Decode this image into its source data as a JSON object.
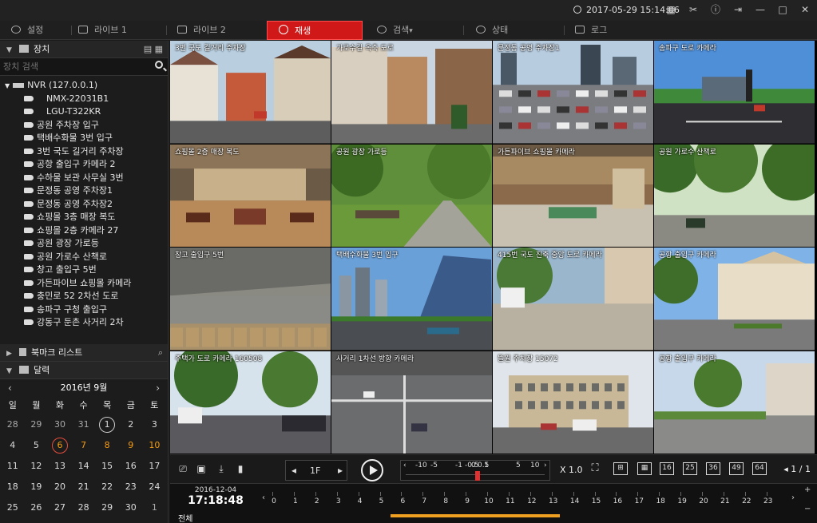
{
  "titlebar": {
    "datetime": "2017-05-29 15:14:06"
  },
  "tabs": [
    {
      "label": "설정",
      "active": false
    },
    {
      "label": "라이브 1",
      "active": false
    },
    {
      "label": "라이브 2",
      "active": false
    },
    {
      "label": "재생",
      "active": true
    },
    {
      "label": "검색",
      "active": false
    },
    {
      "label": "상태",
      "active": false
    },
    {
      "label": "로그",
      "active": false
    }
  ],
  "sidebar": {
    "device_title": "장치",
    "search_placeholder": "장치 검색",
    "nvr": "NVR (127.0.0.1)",
    "cameras": [
      "NMX-22031B1",
      "LGU-T322KR",
      "공원 주차장 입구",
      "택배수화물 3번 입구",
      "3번 국도 길거리 주차장",
      "공항 출입구 카메라 2",
      "수하물 보관 사무실 3번",
      "문정동 공영 주차장1",
      "문정동 공영 주차장2",
      "쇼핑몰 3층 매장 복도",
      "쇼핑몰 2층 카메라 27",
      "공원 광장 가로등",
      "공원 가로수 산책로",
      "창고 출입구 5번",
      "가든파이브 쇼핑몰 카메라",
      "충민로 52 2차선 도로",
      "송파구 구청 출입구",
      "강동구 둔촌 사거리 2차"
    ],
    "bookmark_title": "북마크 리스트",
    "calendar_title": "달력",
    "calendar": {
      "month": "2016년 9월",
      "dow": [
        "일",
        "월",
        "화",
        "수",
        "목",
        "금",
        "토"
      ],
      "days": [
        [
          "28",
          "29",
          "30",
          "31",
          "1",
          "2",
          "3"
        ],
        [
          "4",
          "5",
          "6",
          "7",
          "8",
          "9",
          "10"
        ],
        [
          "11",
          "12",
          "13",
          "14",
          "15",
          "16",
          "17"
        ],
        [
          "18",
          "19",
          "20",
          "21",
          "22",
          "23",
          "24"
        ],
        [
          "25",
          "26",
          "27",
          "28",
          "29",
          "30",
          "1"
        ]
      ]
    }
  },
  "tiles": [
    {
      "label": "3번 국도 길거리 주차장",
      "scene": "street"
    },
    {
      "label": "가로수길 옥축 도로",
      "scene": "street2"
    },
    {
      "label": "문정동 공영 주차장1",
      "scene": "parking"
    },
    {
      "label": "송파구 도로 카메라",
      "scene": "road"
    },
    {
      "label": "쇼핑몰 2층 매장 복도",
      "scene": "mall"
    },
    {
      "label": "공원 광장 가로등",
      "scene": "park"
    },
    {
      "label": "가든파이브 쇼핑몰 카메라",
      "scene": "mall2"
    },
    {
      "label": "공원 가로수 산책로",
      "scene": "trees"
    },
    {
      "label": "창고 출입구 5번",
      "scene": "warehouse"
    },
    {
      "label": "택배수화물 3번 입구",
      "scene": "city"
    },
    {
      "label": "415번 국도 진축 중앙 도로 카메라",
      "scene": "plaza"
    },
    {
      "label": "공항 출입구 카메라",
      "scene": "airport"
    },
    {
      "label": "주택가 도로 카메라 160508",
      "scene": "avenue"
    },
    {
      "label": "사거리 1차선 방향 카메라",
      "scene": "crossing"
    },
    {
      "label": "뜰원 주차장 15072",
      "scene": "building"
    },
    {
      "label": "공항 출입구 카메라",
      "scene": "suburb"
    }
  ],
  "controls": {
    "frame": "1F",
    "speed_marks": [
      "-10",
      "-5",
      "-1",
      "-0.5",
      "0",
      "0.5",
      "1",
      "5",
      "10"
    ],
    "speed_value": "X 1.0",
    "layouts": [
      "16",
      "25",
      "36",
      "49",
      "64"
    ],
    "page": "1 / 1"
  },
  "timeline": {
    "date": "2016-12-04",
    "time": "17:18:48",
    "all_label": "전체",
    "hours": [
      "0",
      "1",
      "2",
      "3",
      "4",
      "5",
      "6",
      "7",
      "8",
      "9",
      "10",
      "11",
      "12",
      "13",
      "14",
      "15",
      "16",
      "17",
      "18",
      "19",
      "20",
      "21",
      "22",
      "23"
    ]
  },
  "colors": {
    "accent": "#d01818",
    "record": "#f0a020",
    "highlight_day": "#f39c12"
  }
}
